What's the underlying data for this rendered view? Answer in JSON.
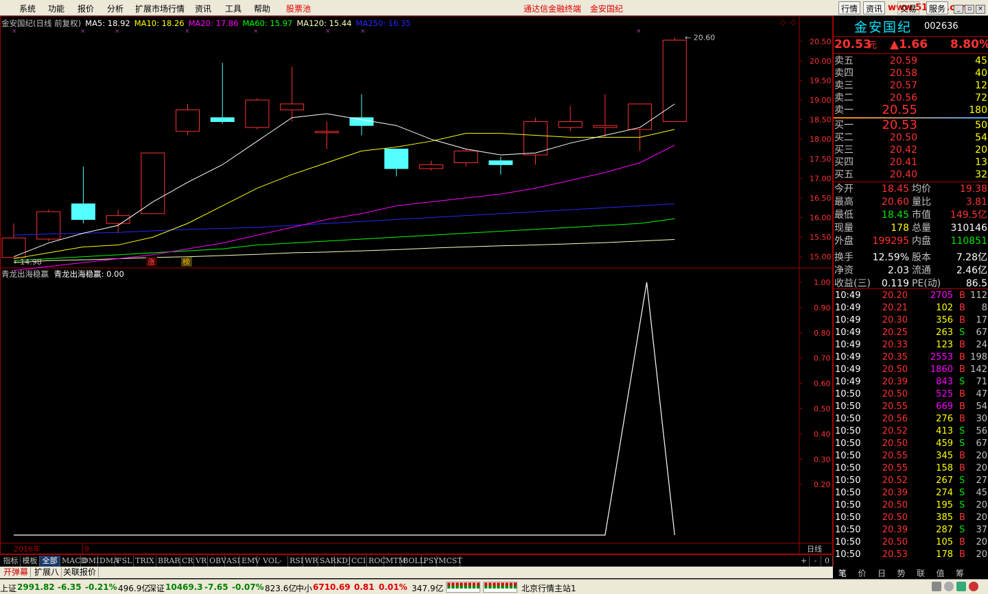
{
  "menu": [
    "系统",
    "功能",
    "报价",
    "分析",
    "扩展市场行情",
    "资讯",
    "工具",
    "帮助",
    "股票池"
  ],
  "menu_center": [
    "通达信金融终端",
    "金安国纪"
  ],
  "top_buttons": [
    "行情",
    "资讯",
    "交易",
    "服务"
  ],
  "watermark": "www.51188.com",
  "chart_header": {
    "title": "金安国纪(日线 前复权)",
    "ma5": "MA5: 18.92",
    "ma10": "MA10: 18.26",
    "ma20": "MA20: 17.86",
    "ma60": "MA60: 15.97",
    "ma120": "MA120: 15.44",
    "ma250": "MA250: 16.35"
  },
  "indicator_header": {
    "name": "青龙出海稳赢",
    "value": "青龙出海稳赢: 0.00"
  },
  "price_axis": [
    "20.50",
    "20.00",
    "19.50",
    "19.00",
    "18.50",
    "18.00",
    "17.50",
    "17.00",
    "16.50",
    "16.00",
    "15.50",
    "15.00"
  ],
  "ind_axis": [
    "1.00",
    "0.90",
    "0.80",
    "0.70",
    "0.60",
    "0.50",
    "0.40",
    "0.30",
    "0.20"
  ],
  "marks": {
    "high": "20.60",
    "low": "14.98",
    "zhang": "涨",
    "bang": "榜"
  },
  "xaxis": {
    "year": "2016年",
    "month": "9",
    "period": "日线"
  },
  "colors": {
    "up": "#ff3232",
    "down": "#54ffff",
    "ma5": "#ffffff",
    "ma10": "#ffff00",
    "ma20": "#ff00ff",
    "ma60": "#00ff00",
    "ma120": "#ffffc0",
    "ma250": "#2828ff",
    "frame": "#a00000"
  },
  "chart_data": {
    "type": "candlestick",
    "ylim": [
      14.75,
      20.75
    ],
    "candles": [
      {
        "o": 14.98,
        "c": 15.48,
        "h": 15.85,
        "l": 14.98
      },
      {
        "o": 15.45,
        "c": 16.15,
        "h": 16.2,
        "l": 15.4
      },
      {
        "o": 16.35,
        "c": 15.95,
        "h": 17.3,
        "l": 15.85
      },
      {
        "o": 15.85,
        "c": 16.05,
        "h": 16.2,
        "l": 15.6
      },
      {
        "o": 16.1,
        "c": 17.65,
        "h": 17.65,
        "l": 16.1
      },
      {
        "o": 18.2,
        "c": 18.75,
        "h": 18.9,
        "l": 18.1
      },
      {
        "o": 18.55,
        "c": 18.45,
        "h": 19.95,
        "l": 18.4
      },
      {
        "o": 18.3,
        "c": 19.0,
        "h": 19.05,
        "l": 18.25
      },
      {
        "o": 18.75,
        "c": 18.9,
        "h": 19.85,
        "l": 18.45
      },
      {
        "o": 18.2,
        "c": 18.2,
        "h": 18.45,
        "l": 17.75
      },
      {
        "o": 18.55,
        "c": 18.35,
        "h": 19.15,
        "l": 18.1
      },
      {
        "o": 17.75,
        "c": 17.25,
        "h": 17.75,
        "l": 17.05
      },
      {
        "o": 17.25,
        "c": 17.35,
        "h": 17.45,
        "l": 17.2
      },
      {
        "o": 17.4,
        "c": 17.7,
        "h": 17.75,
        "l": 17.3
      },
      {
        "o": 17.45,
        "c": 17.35,
        "h": 17.55,
        "l": 17.1
      },
      {
        "o": 17.6,
        "c": 18.45,
        "h": 18.55,
        "l": 17.35
      },
      {
        "o": 18.3,
        "c": 18.45,
        "h": 18.85,
        "l": 18.2
      },
      {
        "o": 18.3,
        "c": 18.35,
        "h": 19.15,
        "l": 18.05
      },
      {
        "o": 18.25,
        "c": 18.9,
        "h": 18.9,
        "l": 17.7
      },
      {
        "o": 18.45,
        "c": 20.53,
        "h": 20.6,
        "l": 18.45
      }
    ],
    "ma5": [
      15.0,
      15.35,
      15.6,
      15.8,
      16.4,
      16.9,
      17.35,
      17.95,
      18.55,
      18.65,
      18.5,
      18.35,
      18.0,
      17.75,
      17.6,
      17.65,
      17.9,
      18.1,
      18.3,
      18.9
    ],
    "ma10": [
      14.95,
      15.1,
      15.25,
      15.3,
      15.5,
      15.85,
      16.3,
      16.75,
      17.1,
      17.4,
      17.7,
      17.8,
      17.95,
      18.15,
      18.15,
      18.1,
      18.05,
      18.05,
      18.05,
      18.25
    ],
    "ma20": [
      14.65,
      14.75,
      14.85,
      14.95,
      15.05,
      15.2,
      15.35,
      15.55,
      15.75,
      15.95,
      16.1,
      16.3,
      16.4,
      16.5,
      16.6,
      16.75,
      16.95,
      17.15,
      17.4,
      17.85
    ],
    "ma60": [
      14.9,
      14.95,
      15.0,
      15.05,
      15.1,
      15.15,
      15.2,
      15.3,
      15.35,
      15.4,
      15.45,
      15.5,
      15.55,
      15.6,
      15.65,
      15.7,
      15.75,
      15.8,
      15.85,
      15.97
    ],
    "ma120": [
      14.85,
      14.9,
      14.92,
      14.95,
      14.98,
      15.0,
      15.03,
      15.06,
      15.1,
      15.12,
      15.15,
      15.18,
      15.22,
      15.25,
      15.28,
      15.3,
      15.33,
      15.36,
      15.4,
      15.44
    ],
    "ma250": [
      15.55,
      15.58,
      15.6,
      15.62,
      15.66,
      15.7,
      15.72,
      15.75,
      15.8,
      15.85,
      15.9,
      15.95,
      16.0,
      16.05,
      16.1,
      16.15,
      16.2,
      16.25,
      16.3,
      16.35
    ],
    "indicator": [
      0,
      0,
      0,
      0,
      0,
      0,
      0,
      0,
      0,
      0,
      0,
      0,
      0,
      0,
      0,
      0,
      0,
      0,
      1,
      0
    ]
  },
  "quote": {
    "name": "金安国纪",
    "code": "002636",
    "price": "20.53",
    "unit": "元",
    "change": "▲1.66",
    "pct": "8.80%"
  },
  "asks": [
    {
      "label": "卖五",
      "price": "20.59",
      "vol": "45"
    },
    {
      "label": "卖四",
      "price": "20.58",
      "vol": "40"
    },
    {
      "label": "卖三",
      "price": "20.57",
      "vol": "12"
    },
    {
      "label": "卖二",
      "price": "20.56",
      "vol": "72"
    },
    {
      "label": "卖一",
      "price": "20.55",
      "vol": "180"
    }
  ],
  "bids": [
    {
      "label": "买一",
      "price": "20.53",
      "vol": "50"
    },
    {
      "label": "买二",
      "price": "20.50",
      "vol": "54"
    },
    {
      "label": "买三",
      "price": "20.42",
      "vol": "20"
    },
    {
      "label": "买四",
      "price": "20.41",
      "vol": "13"
    },
    {
      "label": "买五",
      "price": "20.40",
      "vol": "32"
    }
  ],
  "stats": [
    [
      "今开",
      "18.45",
      "均价",
      "19.38"
    ],
    [
      "最高",
      "20.60",
      "量比",
      "3.81"
    ],
    [
      "最低",
      "18.45",
      "市值",
      "149.5亿"
    ],
    [
      "现量",
      "178",
      "总量",
      "310146"
    ],
    [
      "外盘",
      "199295",
      "内盘",
      "110851"
    ],
    [
      "换手",
      "12.59%",
      "股本",
      "7.28亿"
    ],
    [
      "净资",
      "2.03",
      "流通",
      "2.46亿"
    ],
    [
      "收益(三)",
      "0.119",
      "PE(动)",
      "86.5"
    ]
  ],
  "ticks": [
    [
      "10:49",
      "20.20",
      "2705",
      "B",
      "112"
    ],
    [
      "10:49",
      "20.21",
      "102",
      "B",
      "8"
    ],
    [
      "10:49",
      "20.30",
      "356",
      "B",
      "17"
    ],
    [
      "10:49",
      "20.25",
      "263",
      "S",
      "67"
    ],
    [
      "10:49",
      "20.33",
      "123",
      "B",
      "24"
    ],
    [
      "10:49",
      "20.35",
      "2553",
      "B",
      "198"
    ],
    [
      "10:49",
      "20.50",
      "1860",
      "B",
      "142"
    ],
    [
      "10:49",
      "20.39",
      "843",
      "S",
      "71"
    ],
    [
      "10:50",
      "20.50",
      "525",
      "B",
      "47"
    ],
    [
      "10:50",
      "20.55",
      "669",
      "B",
      "54"
    ],
    [
      "10:50",
      "20.56",
      "276",
      "B",
      "30"
    ],
    [
      "10:50",
      "20.52",
      "413",
      "S",
      "56"
    ],
    [
      "10:50",
      "20.50",
      "459",
      "S",
      "67"
    ],
    [
      "10:50",
      "20.55",
      "345",
      "B",
      "20"
    ],
    [
      "10:50",
      "20.55",
      "158",
      "B",
      "20"
    ],
    [
      "10:50",
      "20.52",
      "267",
      "S",
      "27"
    ],
    [
      "10:50",
      "20.39",
      "274",
      "S",
      "45"
    ],
    [
      "10:50",
      "20.50",
      "195",
      "S",
      "20"
    ],
    [
      "10:50",
      "20.50",
      "385",
      "B",
      "20"
    ],
    [
      "10:50",
      "20.39",
      "287",
      "S",
      "37"
    ],
    [
      "10:50",
      "20.50",
      "105",
      "B",
      "20"
    ],
    [
      "10:50",
      "20.53",
      "178",
      "B",
      "20"
    ]
  ],
  "tabs": [
    "指标",
    "模板",
    "全部",
    "MACD",
    "DMI",
    "DMA",
    "FSL",
    "TRIX",
    "BRAR",
    "CR",
    "VR",
    "OBV",
    "ASI",
    "EMV",
    "VOL-TDX",
    "RSI",
    "WR",
    "SAR",
    "KDJ",
    "CCI",
    "ROC",
    "MTM",
    "BOLL",
    "PSY",
    "MCST"
  ],
  "tab_ctrl": [
    "+",
    "-",
    "0"
  ],
  "tabs2": [
    "开弹幕",
    "扩展八",
    "关联报价"
  ],
  "rp_tabs": [
    "笔",
    "价",
    "日",
    "势",
    "联",
    "值",
    "筹"
  ],
  "status": {
    "sh_name": "上证",
    "sh_val": "2991.82",
    "sh_chg": "-6.35",
    "sh_pct": "-0.21%",
    "sh_amt": "496.9亿",
    "sz_name": "深证",
    "sz_val": "10469.3",
    "sz_chg": "-7.65",
    "sz_pct": "-0.07%",
    "sz_amt": "823.6亿",
    "zx_name": "中小",
    "zx_val": "6710.69",
    "zx_chg": "0.81",
    "zx_pct": "0.01%",
    "zx_amt": "347.9亿",
    "server": "北京行情主站1"
  }
}
